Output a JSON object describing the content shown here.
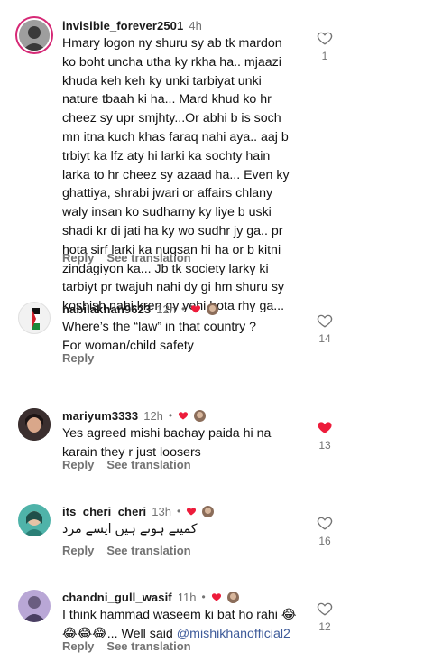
{
  "colors": {
    "like_active": "#ed1c3b",
    "meta_text": "#737373",
    "mention": "#3d5a99"
  },
  "labels": {
    "reply": "Reply",
    "see_translation": "See translation"
  },
  "comments": [
    {
      "username": "invisible_forever2501",
      "time": "4h",
      "text": "Hmary logon ny shuru sy ab tk mardon\nko boht uncha utha ky rkha ha.. mjaazi\nkhuda keh keh ky unki tarbiyat unki\nnature tbaah ki ha... Mard khud ko hr\ncheez sy upr smjhty...Or abhi b is soch\nmn itna kuch khas faraq nahi aya.. aaj b\ntrbiyt ka lfz aty hi larki ka sochty hain\nlarka to hr cheez sy azaad ha... Even ky\nghattiya, shrabi jwari or affairs chlany\nwaly insan ko sudharny ky liye b uski\nshadi kr di jati ha ky wo sudhr jy ga.. pr\nhota sirf larki ka nuqsan hi ha or b kitni\nzindagiyon ka... Jb tk society larky ki\ntarbiyt pr twajuh nahi dy gi hm shuru sy\nkoshish nahi kren gy yehi hota rhy ga...",
      "likes": "1",
      "liked": false
    },
    {
      "username": "nabilakhan9623",
      "time": "12h",
      "text": "Where’s the “law” in that country ?\nFor woman/child safety",
      "likes": "14",
      "liked": false
    },
    {
      "username": "mariyum3333",
      "time": "12h",
      "text": "Yes agreed mishi bachay paida hi na\nkarain they r just loosers",
      "likes": "13",
      "liked": true
    },
    {
      "username": "its_cheri_cheri",
      "time": "13h",
      "text": "کمینے ہوتے ہیں ایسے مرد",
      "likes": "16",
      "liked": false
    },
    {
      "username": "chandni_gull_wasif",
      "time": "11h",
      "text_before": "I think hammad waseem ki bat ho rahi 😂\n😂😂😂... Well said ",
      "mention": "@mishikhanofficial2",
      "likes": "12",
      "liked": false
    }
  ]
}
